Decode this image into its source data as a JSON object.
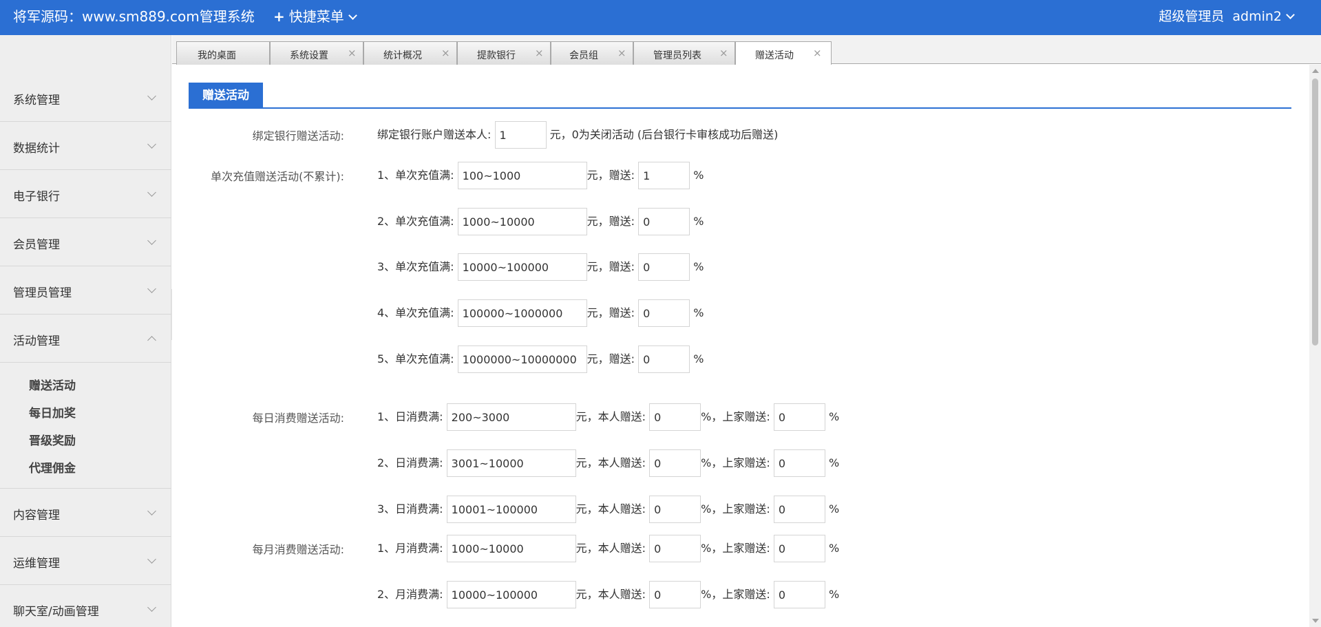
{
  "header": {
    "brand": "将军源码：www.sm889.com管理系统",
    "quick_menu": "快捷菜单",
    "role": "超级管理员",
    "username": "admin2"
  },
  "sidebar": {
    "items_top": [
      {
        "label": "系统管理"
      },
      {
        "label": "数据统计"
      },
      {
        "label": "电子银行"
      },
      {
        "label": "会员管理"
      },
      {
        "label": "管理员管理"
      },
      {
        "label": "活动管理"
      }
    ],
    "sub_items": [
      {
        "label": "赠送活动"
      },
      {
        "label": "每日加奖"
      },
      {
        "label": "晋级奖励"
      },
      {
        "label": "代理佣金"
      }
    ],
    "items_bottom": [
      {
        "label": "内容管理"
      },
      {
        "label": "运维管理"
      },
      {
        "label": "聊天室/动画管理"
      }
    ]
  },
  "tabs": [
    {
      "label": "我的桌面",
      "closable": false
    },
    {
      "label": "系统设置",
      "closable": true
    },
    {
      "label": "统计概况",
      "closable": true
    },
    {
      "label": "提款银行",
      "closable": true
    },
    {
      "label": "会员组",
      "closable": true
    },
    {
      "label": "管理员列表",
      "closable": true
    },
    {
      "label": "赠送活动",
      "closable": true,
      "active": true
    }
  ],
  "close_glyph": "×",
  "panel": {
    "title": "赠送活动",
    "bank_bind": {
      "label": "绑定银行赠送活动:",
      "prefix": "绑定银行账户赠送本人:",
      "value": "1",
      "suffix": "元，0为关闭活动 (后台银行卡审核成功后赠送)"
    },
    "single_recharge": {
      "label": "单次充值赠送活动(不累计):",
      "unit_yuan": "元，赠送:",
      "percent": "%",
      "rows": [
        {
          "prefix": "1、单次充值满:",
          "range": "100~1000",
          "rate": "1"
        },
        {
          "prefix": "2、单次充值满:",
          "range": "1000~10000",
          "rate": "0"
        },
        {
          "prefix": "3、单次充值满:",
          "range": "10000~100000",
          "rate": "0"
        },
        {
          "prefix": "4、单次充值满:",
          "range": "100000~1000000",
          "rate": "0"
        },
        {
          "prefix": "5、单次充值满:",
          "range": "1000000~10000000",
          "rate": "0"
        }
      ]
    },
    "daily_spend": {
      "label": "每日消费赠送活动:",
      "self_label": "元，本人赠送:",
      "upper_label": "%，上家赠送:",
      "percent": "%",
      "rows": [
        {
          "prefix": "1、日消费满:",
          "range": "200~3000",
          "self": "0",
          "upper": "0"
        },
        {
          "prefix": "2、日消费满:",
          "range": "3001~10000",
          "self": "0",
          "upper": "0"
        },
        {
          "prefix": "3、日消费满:",
          "range": "10001~100000",
          "self": "0",
          "upper": "0"
        }
      ]
    },
    "monthly_spend": {
      "label": "每月消费赠送活动:",
      "self_label": "元，本人赠送:",
      "upper_label": "%，上家赠送:",
      "percent": "%",
      "rows": [
        {
          "prefix": "1、月消费满:",
          "range": "1000~10000",
          "self": "0",
          "upper": "0"
        },
        {
          "prefix": "2、月消费满:",
          "range": "10000~100000",
          "self": "0",
          "upper": "0"
        }
      ]
    }
  }
}
